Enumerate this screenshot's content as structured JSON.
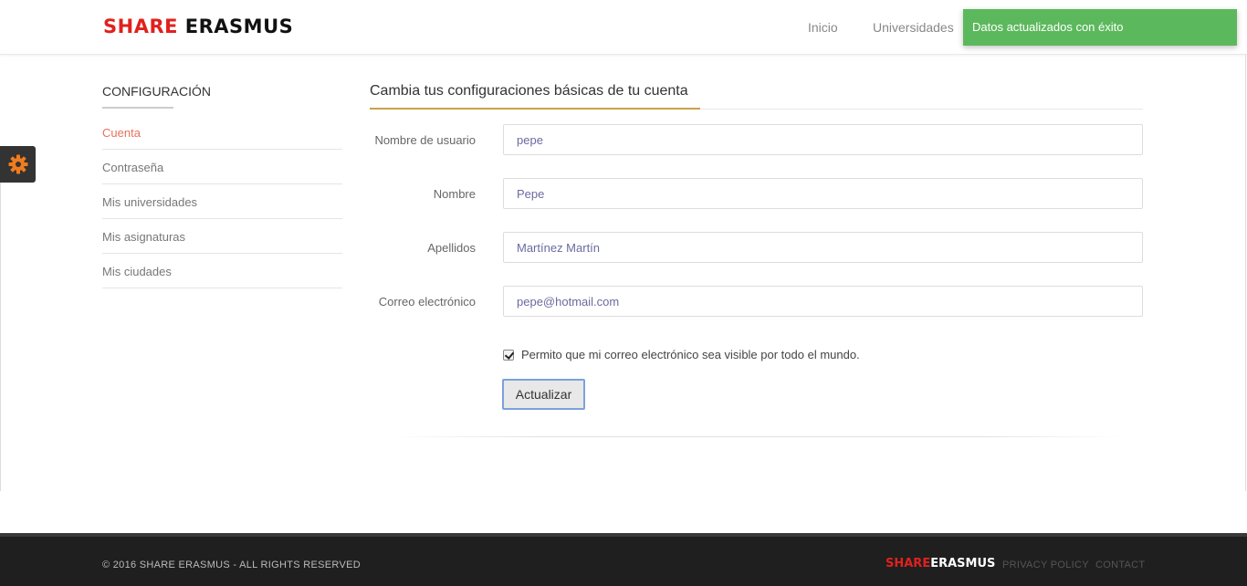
{
  "header": {
    "logo_part1": "SHARE",
    "logo_part2": "ERASMUS",
    "nav": [
      "Inicio",
      "Universidades"
    ],
    "toast": "Datos actualizados con éxito"
  },
  "sidebar": {
    "title": "CONFIGURACIÓN",
    "items": [
      "Cuenta",
      "Contraseña",
      "Mis universidades",
      "Mis asignaturas",
      "Mis ciudades"
    ],
    "active_index": 0
  },
  "main": {
    "title": "Cambia tus configuraciones básicas de tu cuenta",
    "fields": [
      {
        "label": "Nombre de usuario",
        "value": "pepe"
      },
      {
        "label": "Nombre",
        "value": "Pepe"
      },
      {
        "label": "Apellidos",
        "value": "Martínez Martín"
      },
      {
        "label": "Correo electrónico",
        "value": "pepe@hotmail.com"
      }
    ],
    "checkbox_label": "Permito que mi correo electrónico sea visible por todo el mundo.",
    "checkbox_checked": true,
    "submit_label": "Actualizar"
  },
  "footer": {
    "copyright": "© 2016 SHARE ERASMUS - ALL RIGHTS RESERVED",
    "logo_part1": "SHARE",
    "logo_part2": "ERASMUS",
    "links": [
      "PRIVACY POLICY",
      "CONTACT"
    ]
  },
  "icons": {
    "settings": "gear-icon"
  },
  "colors": {
    "brand_red": "#e0211d",
    "toast_green": "#5cb85c",
    "active_link": "#e8725a",
    "accent_underline": "#c8a24c",
    "gear_orange": "#f07c1e"
  }
}
